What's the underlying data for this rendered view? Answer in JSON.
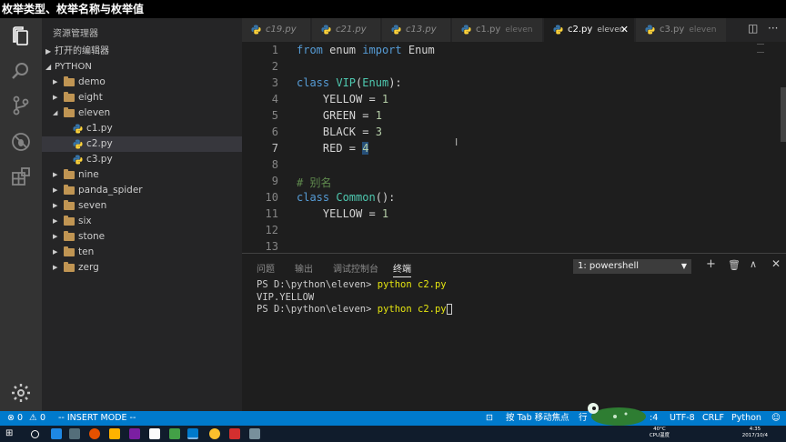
{
  "banner": {
    "title": "枚举类型、枚举名称与枚举值"
  },
  "sidebar": {
    "title": "资源管理器",
    "open_editors": "打开的编辑器",
    "project": "PYTHON",
    "tree": [
      {
        "label": "demo",
        "type": "folder",
        "expanded": false
      },
      {
        "label": "eight",
        "type": "folder",
        "expanded": false
      },
      {
        "label": "eleven",
        "type": "folder",
        "expanded": true
      },
      {
        "label": "c1.py",
        "type": "file"
      },
      {
        "label": "c2.py",
        "type": "file",
        "selected": true
      },
      {
        "label": "c3.py",
        "type": "file"
      },
      {
        "label": "nine",
        "type": "folder",
        "expanded": false
      },
      {
        "label": "panda_spider",
        "type": "folder",
        "expanded": false
      },
      {
        "label": "seven",
        "type": "folder",
        "expanded": false
      },
      {
        "label": "six",
        "type": "folder",
        "expanded": false
      },
      {
        "label": "stone",
        "type": "folder",
        "expanded": false
      },
      {
        "label": "ten",
        "type": "folder",
        "expanded": false
      },
      {
        "label": "zerg",
        "type": "folder",
        "expanded": false
      }
    ]
  },
  "tabs": [
    {
      "name": "c19.py",
      "dir": ""
    },
    {
      "name": "c21.py",
      "dir": ""
    },
    {
      "name": "c13.py",
      "dir": ""
    },
    {
      "name": "c1.py",
      "dir": "eleven"
    },
    {
      "name": "c2.py",
      "dir": "eleven",
      "active": true
    },
    {
      "name": "c3.py",
      "dir": "eleven"
    }
  ],
  "editor": {
    "line_numbers": [
      "1",
      "2",
      "3",
      "4",
      "5",
      "6",
      "7",
      "8",
      "9",
      "10",
      "11",
      "12",
      "13"
    ],
    "lines": {
      "l1": {
        "kw1": "from",
        "mod": " enum ",
        "kw2": "import",
        "name": " Enum"
      },
      "l3": {
        "kw": "class",
        "cls": "VIP",
        "open": "(",
        "base": "Enum",
        "close": "):"
      },
      "l4": {
        "name": "    YELLOW = ",
        "num": "1"
      },
      "l5": {
        "name": "    GREEN = ",
        "num": "1"
      },
      "l6": {
        "name": "    BLACK = ",
        "num": "3"
      },
      "l7": {
        "name": "    RED = ",
        "num": "4"
      },
      "l9": {
        "comment": "# 别名"
      },
      "l10": {
        "kw": "class",
        "cls": "Common",
        "rest": "():"
      },
      "l11": {
        "name": "    YELLOW = ",
        "num": "1"
      }
    }
  },
  "panel": {
    "tabs": [
      "问题",
      "输出",
      "调试控制台",
      "终端"
    ],
    "terminal_select": "1: powershell",
    "terminal_lines": [
      {
        "prompt": "PS D:\\python\\eleven> ",
        "cmd": "python c2.py"
      },
      {
        "output": "VIP.YELLOW"
      },
      {
        "prompt": "PS D:\\python\\eleven> ",
        "cmd": "python c2.py"
      }
    ]
  },
  "status": {
    "errors": "0",
    "warnings": "0",
    "mode": "-- INSERT MODE --",
    "focus_mode": "按 Tab 移动焦点",
    "line_col": "行",
    "spaces": "4",
    "encoding": "UTF-8",
    "eol": "CRLF",
    "language": "Python"
  },
  "taskbar": {
    "temp": "40°C",
    "cpu_label": "CPU温度",
    "time": "4:35",
    "date": "2017/10/4"
  },
  "colors": {
    "accent": "#007acc",
    "keyword": "#569cd6",
    "class": "#4ec9b0",
    "number": "#b5cea8",
    "comment": "#608b4e"
  }
}
